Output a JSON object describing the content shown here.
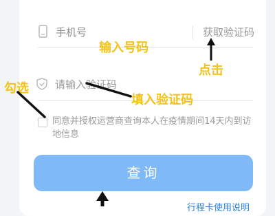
{
  "form": {
    "phone_placeholder": "手机号",
    "get_code_label": "获取验证码",
    "code_placeholder": "请输入验证码",
    "agreement_text": "同意并授权运营商查询本人在疫情期间14天内到访地信息",
    "query_button": "查询",
    "link_text": "行程卡使用说明"
  },
  "annotations": {
    "enter_phone": "输入号码",
    "click": "点击",
    "enter_code": "填入验证码",
    "check": "勾选"
  },
  "colors": {
    "annotation": "#f3c31a",
    "button": "#7fb9f7",
    "link": "#2f7fde"
  },
  "icons": [
    "phone-icon",
    "shield-icon"
  ]
}
